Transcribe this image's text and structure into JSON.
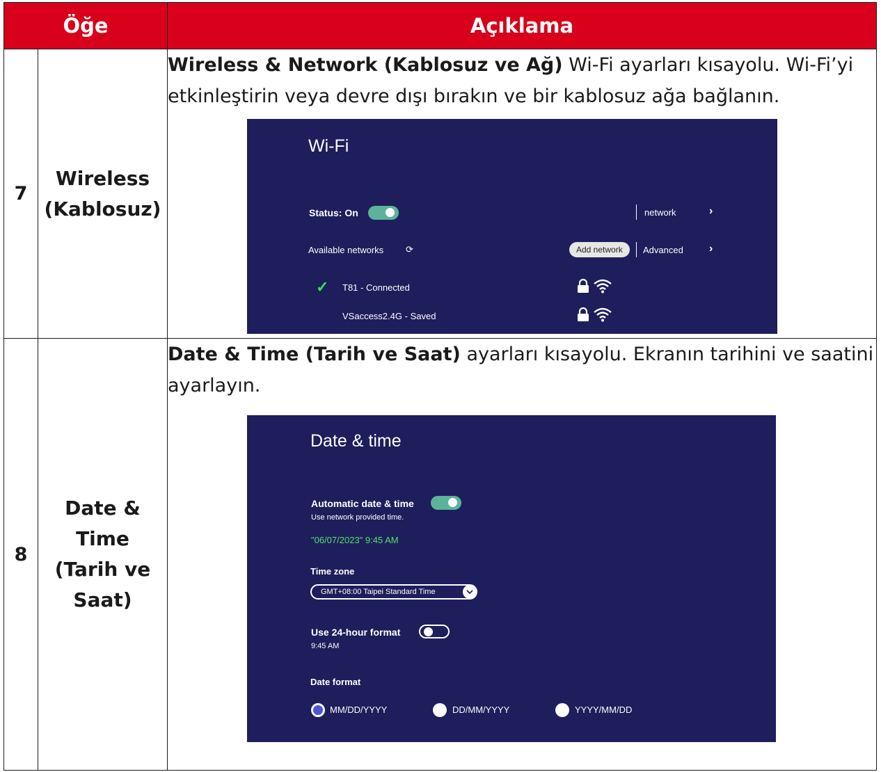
{
  "header": {
    "col_item": "Öğe",
    "col_desc": "Açıklama"
  },
  "rows": [
    {
      "num": "7",
      "name": "Wireless (Kablosuz)",
      "desc_bold": "Wireless & Network (Kablosuz ve Ağ)",
      "desc_rest": " Wi-Fi ayarları kısayolu. Wi-Fi’yi etkinleştirin veya devre dışı bırakın ve bir kablosuz ağa bağlanın.",
      "screen": {
        "title": "Wi-Fi",
        "status_label": "Status: On",
        "status_on": true,
        "menu_network": "network",
        "menu_advanced": "Advanced",
        "available_label": "Available networks",
        "add_network": "Add network",
        "networks": [
          {
            "name": "T81",
            "status": "- Connected",
            "connected": true
          },
          {
            "name": "VSaccess2.4G",
            "status": "- Saved",
            "connected": false
          }
        ]
      }
    },
    {
      "num": "8",
      "name": "Date & Time (Tarih ve Saat)",
      "desc_bold": "Date & Time (Tarih ve Saat)",
      "desc_rest": " ayarları kısayolu. Ekranın tarihini ve saatini ayarlayın.",
      "screen": {
        "title": "Date & time",
        "auto_label": "Automatic date & time",
        "auto_on": true,
        "auto_sub": "Use network provided time.",
        "datetime_value": "\"06/07/2023\"   9:45 AM",
        "tz_label": "Time zone",
        "tz_value": "GMT+08:00 Taipei Standard Time",
        "h24_label": "Use 24-hour format",
        "h24_on": false,
        "h24_sub": "9:45 AM",
        "df_label": "Date format",
        "date_formats": [
          "MM/DD/YYYY",
          "DD/MM/YYYY",
          "YYYY/MM/DD"
        ],
        "date_format_selected": "MM/DD/YYYY"
      }
    }
  ],
  "colors": {
    "header_red": "#d9001b",
    "screen_bg": "#1e1e5c",
    "toggle_on": "#5bb39a",
    "accent_green": "#4ee36a",
    "check_green": "#3fe05a",
    "radio_selected": "#4a55d8"
  }
}
